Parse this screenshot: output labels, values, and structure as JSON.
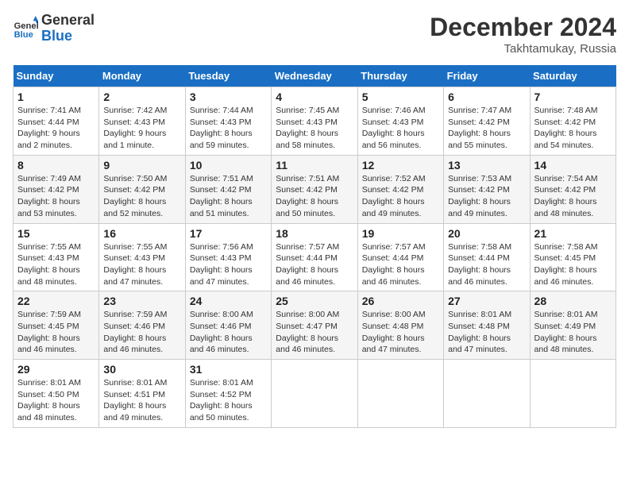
{
  "logo": {
    "text_general": "General",
    "text_blue": "Blue"
  },
  "title": "December 2024",
  "location": "Takhtamukay, Russia",
  "days_header": [
    "Sunday",
    "Monday",
    "Tuesday",
    "Wednesday",
    "Thursday",
    "Friday",
    "Saturday"
  ],
  "weeks": [
    [
      {
        "day": "1",
        "sunrise": "7:41 AM",
        "sunset": "4:44 PM",
        "daylight": "9 hours and 2 minutes."
      },
      {
        "day": "2",
        "sunrise": "7:42 AM",
        "sunset": "4:43 PM",
        "daylight": "9 hours and 1 minute."
      },
      {
        "day": "3",
        "sunrise": "7:44 AM",
        "sunset": "4:43 PM",
        "daylight": "8 hours and 59 minutes."
      },
      {
        "day": "4",
        "sunrise": "7:45 AM",
        "sunset": "4:43 PM",
        "daylight": "8 hours and 58 minutes."
      },
      {
        "day": "5",
        "sunrise": "7:46 AM",
        "sunset": "4:43 PM",
        "daylight": "8 hours and 56 minutes."
      },
      {
        "day": "6",
        "sunrise": "7:47 AM",
        "sunset": "4:42 PM",
        "daylight": "8 hours and 55 minutes."
      },
      {
        "day": "7",
        "sunrise": "7:48 AM",
        "sunset": "4:42 PM",
        "daylight": "8 hours and 54 minutes."
      }
    ],
    [
      {
        "day": "8",
        "sunrise": "7:49 AM",
        "sunset": "4:42 PM",
        "daylight": "8 hours and 53 minutes."
      },
      {
        "day": "9",
        "sunrise": "7:50 AM",
        "sunset": "4:42 PM",
        "daylight": "8 hours and 52 minutes."
      },
      {
        "day": "10",
        "sunrise": "7:51 AM",
        "sunset": "4:42 PM",
        "daylight": "8 hours and 51 minutes."
      },
      {
        "day": "11",
        "sunrise": "7:51 AM",
        "sunset": "4:42 PM",
        "daylight": "8 hours and 50 minutes."
      },
      {
        "day": "12",
        "sunrise": "7:52 AM",
        "sunset": "4:42 PM",
        "daylight": "8 hours and 49 minutes."
      },
      {
        "day": "13",
        "sunrise": "7:53 AM",
        "sunset": "4:42 PM",
        "daylight": "8 hours and 49 minutes."
      },
      {
        "day": "14",
        "sunrise": "7:54 AM",
        "sunset": "4:42 PM",
        "daylight": "8 hours and 48 minutes."
      }
    ],
    [
      {
        "day": "15",
        "sunrise": "7:55 AM",
        "sunset": "4:43 PM",
        "daylight": "8 hours and 48 minutes."
      },
      {
        "day": "16",
        "sunrise": "7:55 AM",
        "sunset": "4:43 PM",
        "daylight": "8 hours and 47 minutes."
      },
      {
        "day": "17",
        "sunrise": "7:56 AM",
        "sunset": "4:43 PM",
        "daylight": "8 hours and 47 minutes."
      },
      {
        "day": "18",
        "sunrise": "7:57 AM",
        "sunset": "4:44 PM",
        "daylight": "8 hours and 46 minutes."
      },
      {
        "day": "19",
        "sunrise": "7:57 AM",
        "sunset": "4:44 PM",
        "daylight": "8 hours and 46 minutes."
      },
      {
        "day": "20",
        "sunrise": "7:58 AM",
        "sunset": "4:44 PM",
        "daylight": "8 hours and 46 minutes."
      },
      {
        "day": "21",
        "sunrise": "7:58 AM",
        "sunset": "4:45 PM",
        "daylight": "8 hours and 46 minutes."
      }
    ],
    [
      {
        "day": "22",
        "sunrise": "7:59 AM",
        "sunset": "4:45 PM",
        "daylight": "8 hours and 46 minutes."
      },
      {
        "day": "23",
        "sunrise": "7:59 AM",
        "sunset": "4:46 PM",
        "daylight": "8 hours and 46 minutes."
      },
      {
        "day": "24",
        "sunrise": "8:00 AM",
        "sunset": "4:46 PM",
        "daylight": "8 hours and 46 minutes."
      },
      {
        "day": "25",
        "sunrise": "8:00 AM",
        "sunset": "4:47 PM",
        "daylight": "8 hours and 46 minutes."
      },
      {
        "day": "26",
        "sunrise": "8:00 AM",
        "sunset": "4:48 PM",
        "daylight": "8 hours and 47 minutes."
      },
      {
        "day": "27",
        "sunrise": "8:01 AM",
        "sunset": "4:48 PM",
        "daylight": "8 hours and 47 minutes."
      },
      {
        "day": "28",
        "sunrise": "8:01 AM",
        "sunset": "4:49 PM",
        "daylight": "8 hours and 48 minutes."
      }
    ],
    [
      {
        "day": "29",
        "sunrise": "8:01 AM",
        "sunset": "4:50 PM",
        "daylight": "8 hours and 48 minutes."
      },
      {
        "day": "30",
        "sunrise": "8:01 AM",
        "sunset": "4:51 PM",
        "daylight": "8 hours and 49 minutes."
      },
      {
        "day": "31",
        "sunrise": "8:01 AM",
        "sunset": "4:52 PM",
        "daylight": "8 hours and 50 minutes."
      },
      null,
      null,
      null,
      null
    ]
  ]
}
